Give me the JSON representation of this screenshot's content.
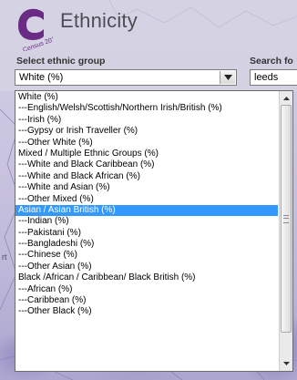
{
  "header": {
    "title": "Ethnicity",
    "logo_text": "Census 2011"
  },
  "selector": {
    "ethnic_group_label": "Select ethnic group",
    "selected_value": "White (%)",
    "search_label": "Search fo",
    "search_value": "leeds"
  },
  "dropdown": {
    "options": [
      "White (%)",
      "---English/Welsh/Scottish/Northern Irish/British (%)",
      "---Irish (%)",
      "---Gypsy or Irish Traveller (%)",
      "---Other White (%)",
      "Mixed / Multiple Ethnic Groups (%)",
      "---White and Black Caribbean (%)",
      "---White and Black African (%)",
      "---White and Asian (%)",
      "---Other Mixed (%)",
      "Asian / Asian British (%)",
      "---Indian (%)",
      "---Pakistani (%)",
      "---Bangladeshi (%)",
      "---Chinese (%)",
      "---Other Asian (%)",
      "Black /African / Caribbean/ Black British (%)",
      "---African (%)",
      "---Caribbean (%)",
      "---Other Black (%)"
    ],
    "highlighted_option": "Asian / Asian British (%)"
  },
  "map_labels": {
    "left_fragment": "rt"
  },
  "icons": {
    "logo": "census-logo-icon",
    "select_arrow": "chevron-down-icon",
    "scroll_up": "scroll-up-arrow-icon",
    "scroll_down": "scroll-down-arrow-icon"
  },
  "colors": {
    "highlight": "#3399ff",
    "logo_purple": "#6a2b85",
    "map_purple": "#8e86bd"
  }
}
